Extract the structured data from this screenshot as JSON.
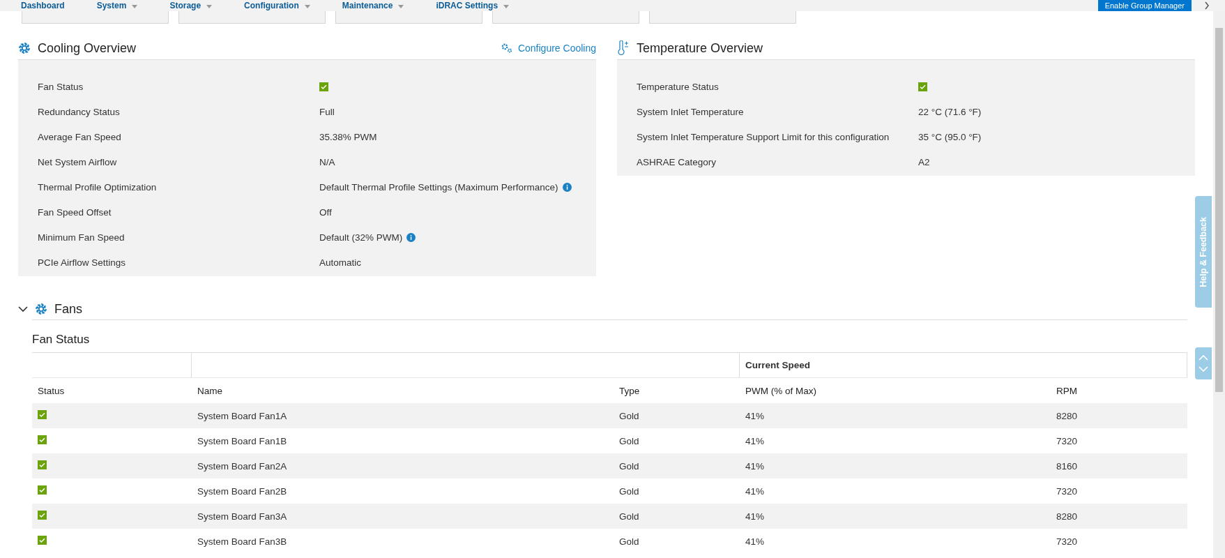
{
  "nav": {
    "items": [
      {
        "label": "Dashboard",
        "caret": false
      },
      {
        "label": "System",
        "caret": true
      },
      {
        "label": "Storage",
        "caret": true
      },
      {
        "label": "Configuration",
        "caret": true
      },
      {
        "label": "Maintenance",
        "caret": true
      },
      {
        "label": "iDRAC Settings",
        "caret": true
      }
    ],
    "action": "Enable Group Manager"
  },
  "cooling": {
    "title": "Cooling Overview",
    "action": "Configure Cooling",
    "rows": [
      {
        "kind": "status",
        "label": "Fan Status",
        "ok": true
      },
      {
        "kind": "text",
        "label": "Redundancy Status",
        "value": "Full",
        "info": false
      },
      {
        "kind": "text",
        "label": "Average Fan Speed",
        "value": "35.38% PWM",
        "info": false
      },
      {
        "kind": "text",
        "label": "Net System Airflow",
        "value": "N/A",
        "info": false
      },
      {
        "kind": "text",
        "label": "Thermal Profile Optimization",
        "value": "Default Thermal Profile Settings (Maximum Performance)",
        "info": true
      },
      {
        "kind": "text",
        "label": "Fan Speed Offset",
        "value": "Off",
        "info": false
      },
      {
        "kind": "text",
        "label": "Minimum Fan Speed",
        "value": "Default (32% PWM)",
        "info": true
      },
      {
        "kind": "text",
        "label": "PCIe Airflow Settings",
        "value": "Automatic",
        "info": false
      }
    ]
  },
  "temperature": {
    "title": "Temperature Overview",
    "rows": [
      {
        "kind": "status",
        "label": "Temperature Status",
        "ok": true
      },
      {
        "kind": "text",
        "label": "System Inlet Temperature",
        "value": "22 °C (71.6 °F)",
        "info": false
      },
      {
        "kind": "text",
        "label": "System Inlet Temperature Support Limit for this configuration",
        "value": "35 °C (95.0 °F)",
        "info": false
      },
      {
        "kind": "text",
        "label": "ASHRAE Category",
        "value": "A2",
        "info": false
      }
    ]
  },
  "fans": {
    "title": "Fans",
    "expanded": true,
    "table_title": "Fan Status",
    "group_header": "Current Speed",
    "columns": [
      "Status",
      "Name",
      "Type",
      "PWM (% of Max)",
      "RPM"
    ],
    "rows": [
      {
        "ok": true,
        "name": "System Board Fan1A",
        "type": "Gold",
        "pwm": "41%",
        "rpm": "8280"
      },
      {
        "ok": true,
        "name": "System Board Fan1B",
        "type": "Gold",
        "pwm": "41%",
        "rpm": "7320"
      },
      {
        "ok": true,
        "name": "System Board Fan2A",
        "type": "Gold",
        "pwm": "41%",
        "rpm": "8160"
      },
      {
        "ok": true,
        "name": "System Board Fan2B",
        "type": "Gold",
        "pwm": "41%",
        "rpm": "7320"
      },
      {
        "ok": true,
        "name": "System Board Fan3A",
        "type": "Gold",
        "pwm": "41%",
        "rpm": "8280"
      },
      {
        "ok": true,
        "name": "System Board Fan3B",
        "type": "Gold",
        "pwm": "41%",
        "rpm": "7320"
      }
    ]
  },
  "help_tab": "Help & Feedback"
}
